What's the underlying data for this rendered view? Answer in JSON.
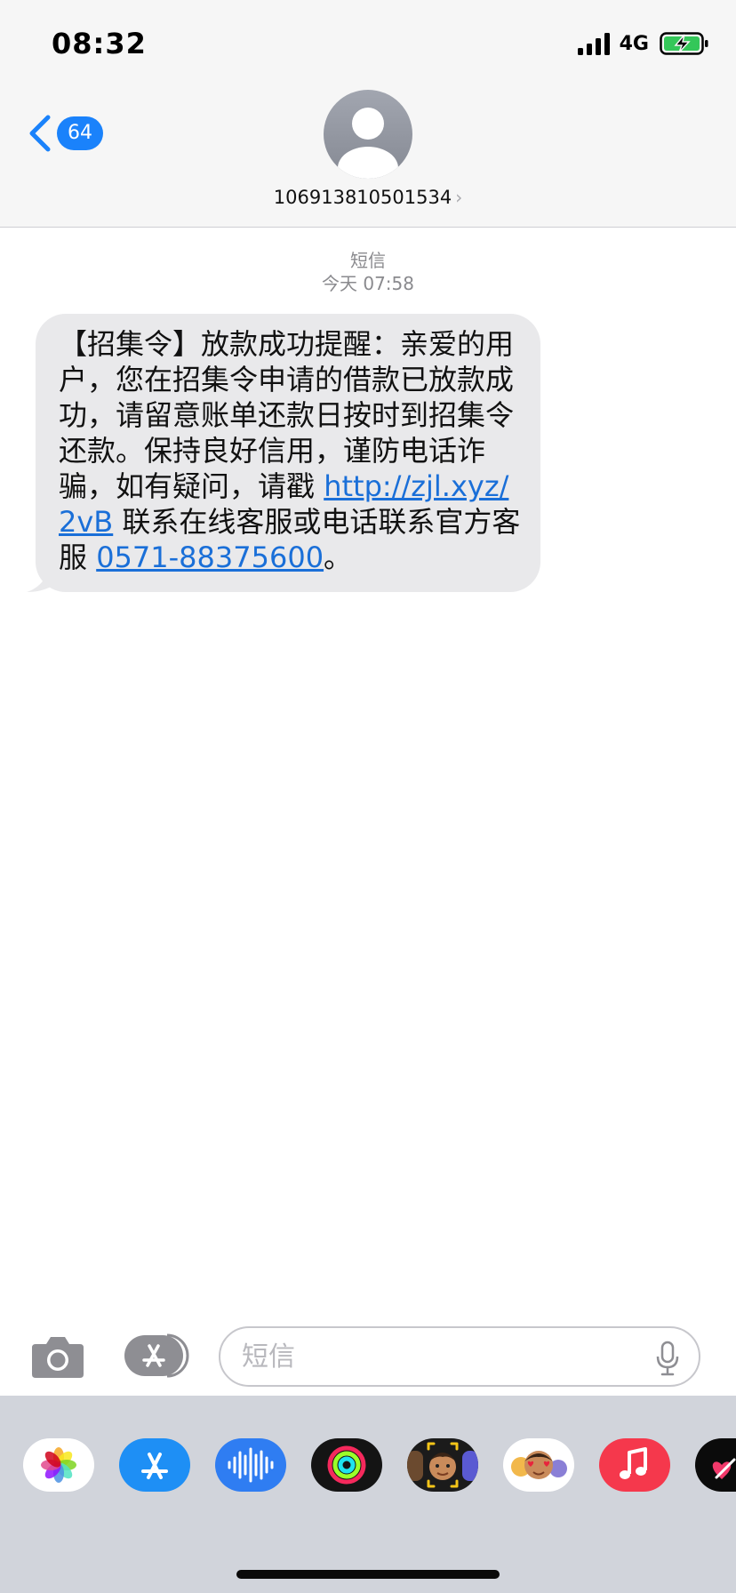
{
  "status_bar": {
    "time": "08:32",
    "network": "4G",
    "icons": [
      "signal-icon",
      "battery-charging-icon"
    ]
  },
  "header": {
    "back_count": "64",
    "contact_number": "106913810501534",
    "contact_chevron": "›",
    "icons": [
      "back-chevron-icon",
      "avatar-icon"
    ]
  },
  "conversation": {
    "channel": "短信",
    "timestamp": "今天 07:58",
    "message": {
      "text_part1": "【招集令】放款成功提醒：亲爱的用户，您在招集令申请的借款已放款成功，请留意账单还款日按时到招集令还款。保持良好信用，谨防电话诈骗，如有疑问，请戳 ",
      "link": "http://zjl.xyz/2vB",
      "text_part2": " 联系在线客服或电话联系官方客服 ",
      "phone": "0571-88375600",
      "text_part3": "。"
    }
  },
  "input_bar": {
    "placeholder": "短信",
    "icons": [
      "camera-icon",
      "appstore-icon",
      "mic-icon"
    ]
  },
  "app_drawer": {
    "apps": [
      "photos-icon",
      "appstore-icon",
      "audio-message-icon",
      "activity-icon",
      "memoji-icon",
      "memoji-stickers-icon",
      "music-icon",
      "digital-touch-icon"
    ]
  },
  "colors": {
    "accent_blue": "#1a82fb",
    "link_blue": "#1a6fd8",
    "bubble_gray": "#e9e9eb",
    "header_bg": "#f6f6f6",
    "drawer_bg": "#d1d4db"
  }
}
